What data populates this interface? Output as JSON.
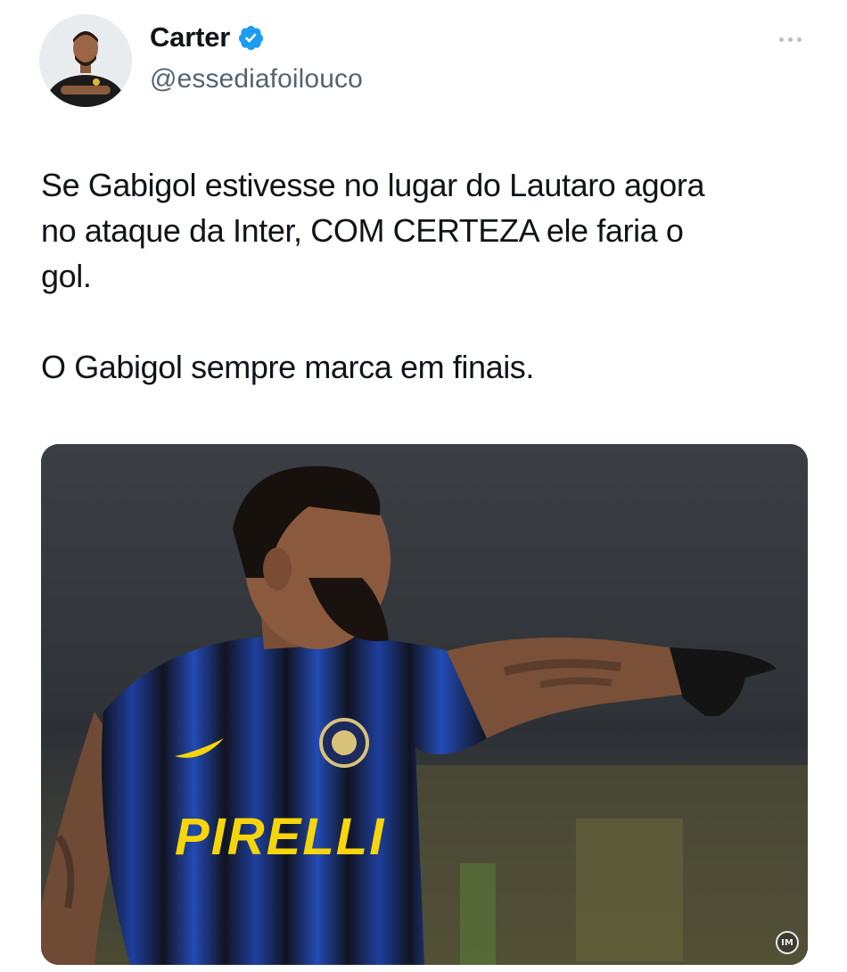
{
  "author": {
    "display_name": "Carter",
    "handle": "@essediafoilouco",
    "verified_icon": "verified-badge-icon",
    "avatar_icon": "user-avatar"
  },
  "more_menu_icon": "more-horizontal-icon",
  "tweet": {
    "text": "Se Gabigol estivesse no lugar do Lautaro agora\nno ataque da Inter, COM CERTEZA ele faria o\ngol.\n\nO Gabigol sempre marca em finais."
  },
  "media": {
    "jersey_sponsor": "PIRELLI",
    "watermark": "IM"
  },
  "colors": {
    "verified": "#1d9bf0",
    "handle": "#536471",
    "text": "#0f1419",
    "jersey_blue": "#1f3f9e",
    "sponsor_yellow": "#f6d60b"
  }
}
